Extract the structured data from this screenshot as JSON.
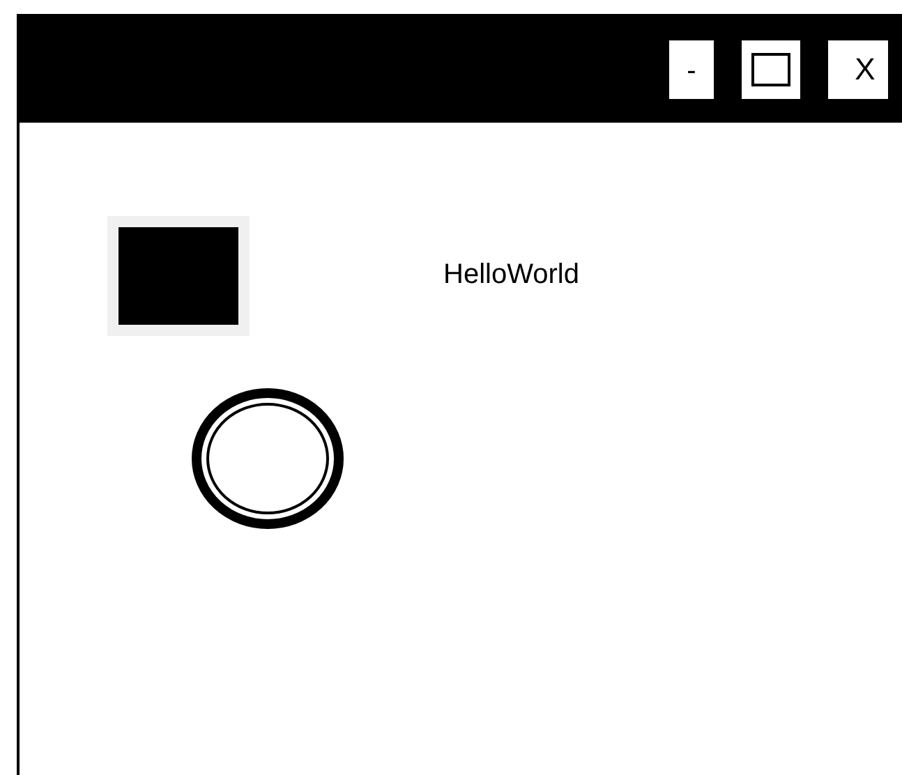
{
  "window": {
    "buttons": [
      {
        "kind": "minimize",
        "label": "-"
      },
      {
        "kind": "maximize"
      },
      {
        "kind": "close",
        "label": "X"
      }
    ]
  },
  "label": "HelloWorld"
}
